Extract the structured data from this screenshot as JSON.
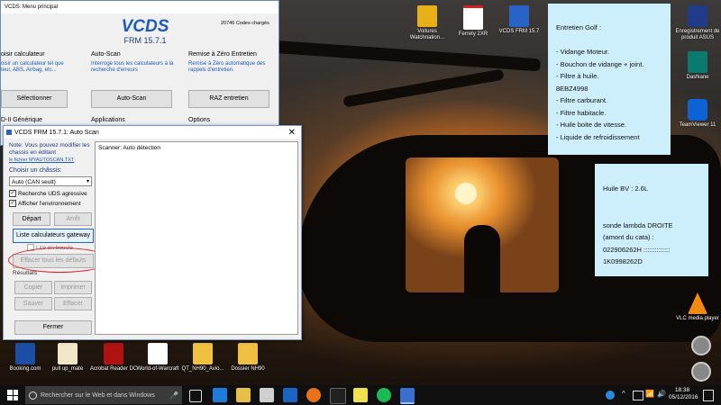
{
  "desktop": {
    "icons_top": [
      {
        "label": "Voitures Watchnation...",
        "color": "#e8b018"
      },
      {
        "label": "Ferrety 2XR",
        "color": "#d62020"
      },
      {
        "label": "VCDS FRM 15.7",
        "color": "#2a63c8"
      }
    ],
    "icons_right": [
      {
        "label": "Enregistrement de produit ASUS",
        "color": "#1f3b8a"
      },
      {
        "label": "DasNane",
        "color": "#0a7a6e"
      },
      {
        "label": "TeamViewer 11",
        "color": "#0d63d6"
      },
      {
        "label": "VLC media player",
        "color": "#f08a10"
      }
    ],
    "icons_bottom": [
      {
        "label": "Booking.com",
        "color": "#1b4fa6"
      },
      {
        "label": "pull up_mate",
        "color": "#f2e6c8"
      },
      {
        "label": "Acrobat Reader DC",
        "color": "#b01212"
      },
      {
        "label": "World-of-Warcraft",
        "color": "#ffffff"
      },
      {
        "label": "QT_NH90_Avio...",
        "color": "#f0c040"
      },
      {
        "label": "Dossier NH90",
        "color": "#f0c040"
      }
    ]
  },
  "main_window": {
    "title": "VCDS: Menu principal",
    "app_name": "VCDS",
    "version": "FRM 15.7.1",
    "codes": "20746 Codes chargés",
    "sections": [
      {
        "heading": "oisir calculateur",
        "desc": "oisir un calculateur tel que\nteur, ABS, Airbag, etc...",
        "button": "Sélectionner"
      },
      {
        "heading": "Auto-Scan",
        "desc": "Interroge tous les calculateurs à la\nrecherche d'erreurs",
        "button": "Auto-Scan"
      },
      {
        "heading": "Remise à Zéro Entretien",
        "desc": "Remise à Zéro automatique des\nrappels d'entretien.",
        "button": "RAZ entretien"
      }
    ],
    "bottom_headings": [
      "D-II Générique",
      "Applications",
      "Options"
    ]
  },
  "autoscan": {
    "title": "VCDS FRM 15.7.1:  Auto Scan",
    "note": "Note:  Vous pouvez modifier les chassis en éditant",
    "note_link": "le fichier MYAUTOSCAN.TXT",
    "choose_label": "Choisir un châssis:",
    "chassis_value": "Auto (CAN seult)",
    "uds_label": "Recherche UDS agressive",
    "env_label": "Afficher l'environnement",
    "start": "Départ",
    "stop": "Arrêt",
    "list_btn": "Liste calculateurs gateway",
    "loop_label": "Lire en boucle",
    "clear_btn": "Effacer tous les défauts",
    "results_label": "Résultats",
    "copy": "Copier",
    "print": "Imprimer",
    "save": "Sauver",
    "erase": "Effacer",
    "close": "Fermer",
    "output": "Scanner: Auto détection"
  },
  "note1": {
    "lines": [
      "Entretien Golf :",
      "",
      "- Vidange Moteur.",
      "- Bouchon de vidange + joint.",
      "- Filtre à huile.",
      "8EBZ4998",
      "- Filtre carburant.",
      "- Filtre habitacle.",
      "- Huile boite de vitesse.",
      "- Liquide de refroidissement"
    ]
  },
  "note2": {
    "lines": [
      "Huile BV : 2.6L",
      "",
      "",
      "sonde lambda DROITE",
      "(amont du cata) :",
      "022906262H         ::::::::::::::",
      "1K0998262D"
    ]
  },
  "taskbar": {
    "search_placeholder": "Rechercher sur le Web et dans Windows",
    "time": "18:38",
    "date": "05/12/2016"
  },
  "colors": {
    "accent_blue": "#1d5bb8",
    "note_bg": "#cdeefb",
    "annotation_red": "#e0181c"
  }
}
